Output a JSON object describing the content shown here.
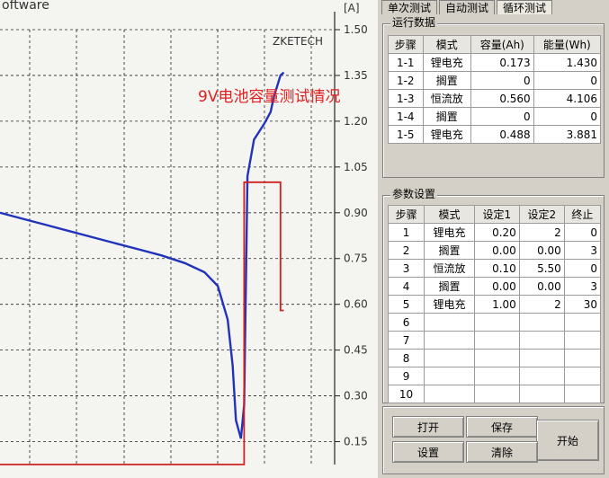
{
  "window": {
    "title_fragment": "oftware"
  },
  "chart": {
    "brand": "ZKETECH",
    "annotation": "9V电池容量测试情况",
    "axis_unit": "[A]",
    "ticks": [
      "1.50",
      "1.35",
      "1.20",
      "1.05",
      "0.90",
      "0.75",
      "0.60",
      "0.45",
      "0.30",
      "0.15"
    ]
  },
  "chart_data": {
    "type": "line",
    "title": "",
    "annotation": "9V电池容量测试情况",
    "right_axis": {
      "unit": "[A]",
      "ylim": [
        0.075,
        1.5
      ],
      "ticks": [
        1.5,
        1.35,
        1.2,
        1.05,
        0.9,
        0.75,
        0.6,
        0.45,
        0.3,
        0.15
      ]
    },
    "x": [
      0,
      0.07,
      0.14,
      0.21,
      0.28,
      0.35,
      0.42,
      0.49,
      0.56,
      0.62,
      0.66,
      0.69,
      0.705,
      0.715,
      0.73,
      0.74,
      0.75,
      0.77,
      0.8,
      0.82,
      0.83,
      0.85,
      0.86
    ],
    "series": [
      {
        "color": "#2233bb",
        "values": [
          0.9,
          0.88,
          0.86,
          0.84,
          0.82,
          0.8,
          0.78,
          0.76,
          0.735,
          0.705,
          0.66,
          0.55,
          0.4,
          0.22,
          0.16,
          0.27,
          1.02,
          1.14,
          1.19,
          1.23,
          1.28,
          1.35,
          1.36
        ]
      },
      {
        "color": "#cc2222",
        "values": [
          0.075,
          0.075,
          0.075,
          0.075,
          0.075,
          0.075,
          0.075,
          0.075,
          0.075,
          0.075,
          0.075,
          0.075,
          0.075,
          0.075,
          0.075,
          1.0,
          1.0,
          1.0,
          1.0,
          1.0,
          1.0,
          0.58,
          0.58
        ]
      }
    ]
  },
  "tabs": [
    "单次测试",
    "自动测试",
    "循环测试"
  ],
  "run_data": {
    "title": "运行数据",
    "columns": [
      "步骤",
      "模式",
      "容量(Ah)",
      "能量(Wh)"
    ],
    "rows": [
      [
        "1-1",
        "锂电充",
        "0.173",
        "1.430"
      ],
      [
        "1-2",
        "搁置",
        "0",
        "0"
      ],
      [
        "1-3",
        "恒流放",
        "0.560",
        "4.106"
      ],
      [
        "1-4",
        "搁置",
        "0",
        "0"
      ],
      [
        "1-5",
        "锂电充",
        "0.488",
        "3.881"
      ]
    ]
  },
  "params": {
    "title": "参数设置",
    "columns": [
      "步骤",
      "模式",
      "设定1",
      "设定2",
      "终止"
    ],
    "rows": [
      [
        "1",
        "锂电充",
        "0.20",
        "2",
        "0"
      ],
      [
        "2",
        "搁置",
        "0.00",
        "0.00",
        "3"
      ],
      [
        "3",
        "恒流放",
        "0.10",
        "5.50",
        "0"
      ],
      [
        "4",
        "搁置",
        "0.00",
        "0.00",
        "3"
      ],
      [
        "5",
        "锂电充",
        "1.00",
        "2",
        "30"
      ],
      [
        "6",
        "",
        "",
        "",
        ""
      ],
      [
        "7",
        "",
        "",
        "",
        ""
      ],
      [
        "8",
        "",
        "",
        "",
        ""
      ],
      [
        "9",
        "",
        "",
        "",
        ""
      ],
      [
        "10",
        "",
        "",
        "",
        ""
      ]
    ]
  },
  "buttons": {
    "open": "打开",
    "save": "保存",
    "start": "开始",
    "settings": "设置",
    "clear": "清除"
  }
}
